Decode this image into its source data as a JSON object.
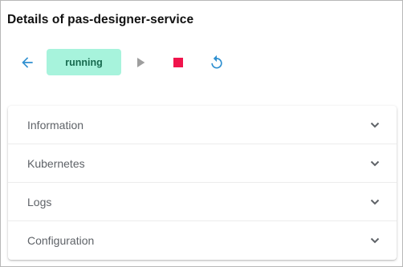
{
  "page": {
    "title": "Details of pas-designer-service"
  },
  "toolbar": {
    "back_icon": "arrow-left-icon",
    "status_label": "running",
    "play_icon": "play-icon",
    "stop_icon": "stop-icon",
    "restart_icon": "restart-icon"
  },
  "colors": {
    "accent_blue": "#2e8fd0",
    "status_bg": "#a7f3dc",
    "status_text": "#16694e",
    "stop_red": "#f0144c",
    "disabled_gray": "#9e9e9e",
    "panel_text": "#5f6368"
  },
  "panels": [
    {
      "label": "Information",
      "icon": "chevron-down-icon"
    },
    {
      "label": "Kubernetes",
      "icon": "chevron-down-icon"
    },
    {
      "label": "Logs",
      "icon": "chevron-down-icon"
    },
    {
      "label": "Configuration",
      "icon": "chevron-down-icon"
    }
  ]
}
